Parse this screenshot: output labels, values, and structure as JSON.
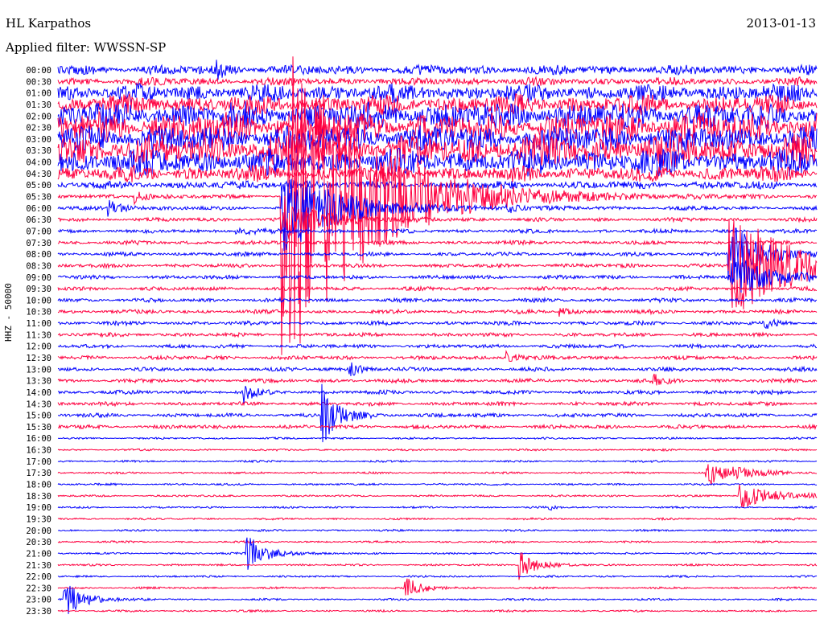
{
  "header": {
    "station": "HL Karpathos",
    "filter": "Applied filter: WWSSN-SP",
    "date": "2013-01-13"
  },
  "chart_data": {
    "type": "line",
    "title": "HL Karpathos",
    "ylabel": "HHZ - 50000",
    "minutes_per_row": 30,
    "colors": [
      "#0000ff",
      "#ff0040"
    ],
    "row_labels": [
      "00:00",
      "00:30",
      "01:00",
      "01:30",
      "02:00",
      "02:30",
      "03:00",
      "03:30",
      "04:00",
      "04:30",
      "05:00",
      "05:30",
      "06:00",
      "06:30",
      "07:00",
      "07:30",
      "08:00",
      "08:30",
      "09:00",
      "09:30",
      "10:00",
      "10:30",
      "11:00",
      "11:30",
      "12:00",
      "12:30",
      "13:00",
      "13:30",
      "14:00",
      "14:30",
      "15:00",
      "15:30",
      "16:00",
      "16:30",
      "17:00",
      "17:30",
      "18:00",
      "18:30",
      "19:00",
      "19:30",
      "20:00",
      "20:30",
      "21:00",
      "21:30",
      "22:00",
      "22:30",
      "23:00",
      "23:30"
    ],
    "noise_level": [
      5,
      4,
      9,
      10,
      14,
      16,
      14,
      16,
      13,
      8,
      4,
      2,
      2,
      2,
      2,
      2,
      2,
      2,
      2,
      2,
      2,
      2,
      2,
      2,
      2,
      2,
      2,
      2,
      2,
      2,
      2,
      2,
      1,
      1,
      1,
      1,
      1,
      1,
      1,
      1,
      1,
      1,
      1,
      1,
      1,
      1,
      1,
      1
    ],
    "events": [
      {
        "row": 0,
        "minute": 6.2,
        "amplitude": 16,
        "decay": 0.3
      },
      {
        "row": 10,
        "minute": 8.8,
        "amplitude": 12,
        "decay": 0.5
      },
      {
        "row": 11,
        "minute": 8.8,
        "amplitude": 240,
        "decay": 3
      },
      {
        "row": 11,
        "minute": 3.0,
        "amplitude": 10,
        "decay": 0.5
      },
      {
        "row": 12,
        "minute": 8.8,
        "amplitude": 60,
        "decay": 2
      },
      {
        "row": 12,
        "minute": 1.9,
        "amplitude": 12,
        "decay": 0.6
      },
      {
        "row": 12,
        "minute": 17.7,
        "amplitude": 8,
        "decay": 0.4
      },
      {
        "row": 13,
        "minute": 8.8,
        "amplitude": 30,
        "decay": 1.5
      },
      {
        "row": 14,
        "minute": 7.0,
        "amplitude": 5,
        "decay": 0.8
      },
      {
        "row": 16,
        "minute": 26.5,
        "amplitude": 40,
        "decay": 1.2
      },
      {
        "row": 17,
        "minute": 26.5,
        "amplitude": 70,
        "decay": 2.5
      },
      {
        "row": 18,
        "minute": 26.5,
        "amplitude": 30,
        "decay": 1.5
      },
      {
        "row": 21,
        "minute": 19.8,
        "amplitude": 6,
        "decay": 0.4
      },
      {
        "row": 22,
        "minute": 27.9,
        "amplitude": 8,
        "decay": 0.3
      },
      {
        "row": 25,
        "minute": 17.7,
        "amplitude": 10,
        "decay": 0.4
      },
      {
        "row": 26,
        "minute": 11.5,
        "amplitude": 12,
        "decay": 0.4
      },
      {
        "row": 27,
        "minute": 23.5,
        "amplitude": 8,
        "decay": 0.4
      },
      {
        "row": 28,
        "minute": 7.3,
        "amplitude": 14,
        "decay": 0.4
      },
      {
        "row": 30,
        "minute": 10.4,
        "amplitude": 40,
        "decay": 0.6
      },
      {
        "row": 35,
        "minute": 25.6,
        "amplitude": 18,
        "decay": 1.2
      },
      {
        "row": 37,
        "minute": 26.9,
        "amplitude": 16,
        "decay": 1.4
      },
      {
        "row": 38,
        "minute": 19.4,
        "amplitude": 4,
        "decay": 0.2
      },
      {
        "row": 42,
        "minute": 7.4,
        "amplitude": 26,
        "decay": 0.7
      },
      {
        "row": 43,
        "minute": 18.2,
        "amplitude": 20,
        "decay": 0.6
      },
      {
        "row": 45,
        "minute": 13.7,
        "amplitude": 14,
        "decay": 0.6
      },
      {
        "row": 46,
        "minute": 0.2,
        "amplitude": 26,
        "decay": 0.7
      }
    ]
  }
}
